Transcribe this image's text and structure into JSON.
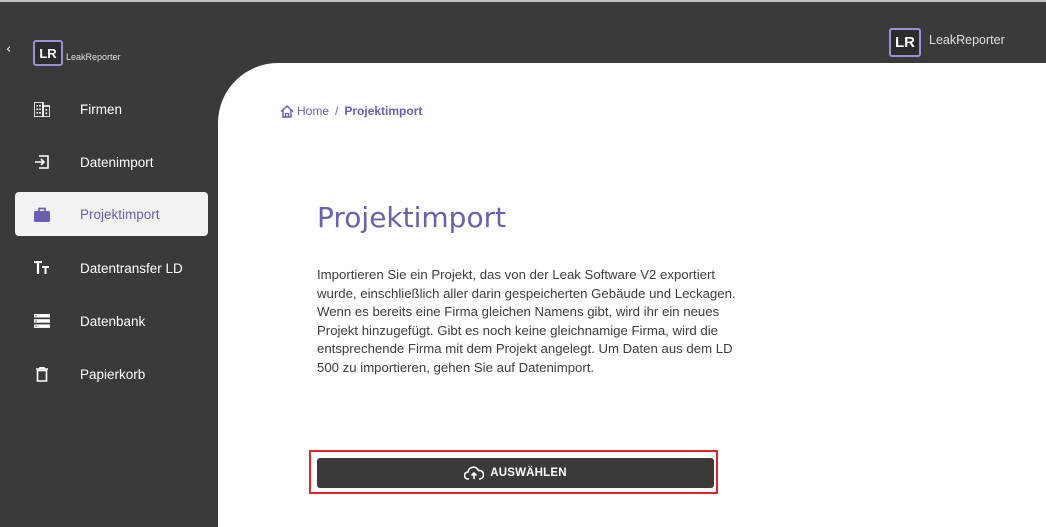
{
  "app": {
    "name": "LeakReporter",
    "logo_letters": "LR"
  },
  "sidebar": {
    "collapse_glyph": "‹",
    "items": [
      {
        "label": "Firmen",
        "icon": "building-icon",
        "active": false
      },
      {
        "label": "Datenimport",
        "icon": "import-icon",
        "active": false
      },
      {
        "label": "Projektimport",
        "icon": "briefcase-icon",
        "active": true
      },
      {
        "label": "Datentransfer LD",
        "icon": "text-size-icon",
        "active": false
      },
      {
        "label": "Datenbank",
        "icon": "storage-icon",
        "active": false
      },
      {
        "label": "Papierkorb",
        "icon": "trash-icon",
        "active": false
      }
    ]
  },
  "breadcrumb": {
    "home": "Home",
    "separator": "/",
    "current": "Projektimport"
  },
  "main": {
    "title": "Projektimport",
    "description": "Importieren Sie ein Projekt, das von der Leak Software V2 exportiert wurde, einschließlich aller darin gespeicherten Gebäude und Leckagen. Wenn es bereits eine Firma gleichen Namens gibt, wird ihr ein neues Projekt hinzugefügt. Gibt es noch keine gleichnamige Firma, wird die entsprechende Firma mit dem Projekt angelegt. Um Daten aus dem LD 500 zu importieren, gehen Sie auf Datenimport.",
    "select_button": {
      "label": "AUSWÄHLEN",
      "icon": "cloud-upload-icon"
    }
  },
  "colors": {
    "sidebar_bg": "#3a3a3a",
    "accent": "#6b5fb0",
    "logo_border": "#9b8fd6",
    "highlight": "#e2242d"
  }
}
